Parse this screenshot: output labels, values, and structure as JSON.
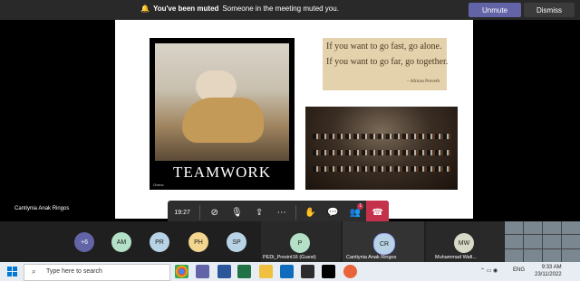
{
  "banner": {
    "title": "You've been muted",
    "message": "Someone in the meeting muted you.",
    "unmute_label": "Unmute",
    "dismiss_label": "Dismiss"
  },
  "slide": {
    "poster_title": "TEAMWORK",
    "poster_caption": "Overw",
    "quote_line1": "If you want to go fast, go alone.",
    "quote_line2": "If you want to go far, go together.",
    "quote_attribution": "– African Proverb"
  },
  "presenter": {
    "name": "Cantiynia Anak Ringos"
  },
  "toolbar": {
    "time": "19:27",
    "participants_badge": "1",
    "icons": [
      "camera-off-icon",
      "mic-off-icon",
      "share-icon",
      "more-icon",
      "raise-hand-icon",
      "chat-icon",
      "participants-icon",
      "hang-up-icon"
    ]
  },
  "gallery": {
    "overflow_count": "+6",
    "avatars": [
      {
        "initials": "AM",
        "color": "#b4e0c8"
      },
      {
        "initials": "PR",
        "color": "#b9d3e6"
      },
      {
        "initials": "PH",
        "color": "#f2d58f"
      },
      {
        "initials": "SP",
        "color": "#b9d3e6"
      }
    ],
    "tiles": [
      {
        "initials": "P",
        "name": "PEDi_Presint16 (Guest)",
        "color": "#b4e0c8"
      },
      {
        "initials": "CR",
        "name": "Cantiynia Anak Ringos",
        "color": "#b9d3e6"
      },
      {
        "initials": "MW",
        "name": "Muhammad Wafi...",
        "color": "#d9d9c8"
      }
    ]
  },
  "taskbar": {
    "search_placeholder": "Type here to search",
    "language": "ENG",
    "time": "9:33 AM",
    "date": "23/11/2022"
  }
}
